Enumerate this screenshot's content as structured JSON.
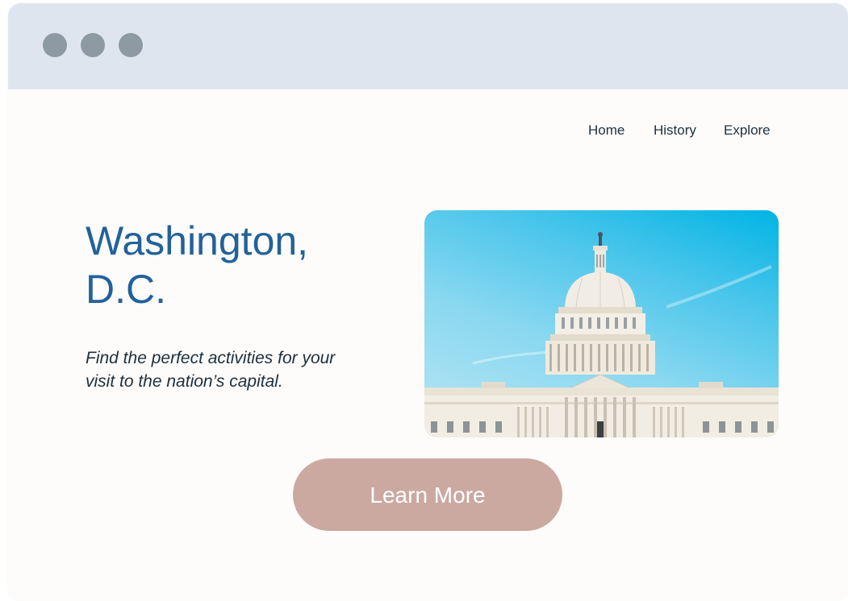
{
  "window": {
    "controls": [
      "close",
      "minimize",
      "maximize"
    ]
  },
  "nav": {
    "items": [
      {
        "label": "Home"
      },
      {
        "label": "History"
      },
      {
        "label": "Explore"
      }
    ]
  },
  "hero": {
    "title_line1": "Washington,",
    "title_line2": "D.C.",
    "subtitle_line1": "Find the perfect activities for your",
    "subtitle_line2": "visit to the nation’s capital.",
    "image_icon": "capitol-building-photo",
    "cta_label": "Learn More"
  },
  "colors": {
    "titlebar": "#dfe5ee",
    "window_dots": "#8e9aa3",
    "page_bg": "#fdfcfb",
    "title": "#22629a",
    "text": "#1d2f3c",
    "cta_bg": "#cba9a1",
    "cta_text": "#ffffff"
  }
}
